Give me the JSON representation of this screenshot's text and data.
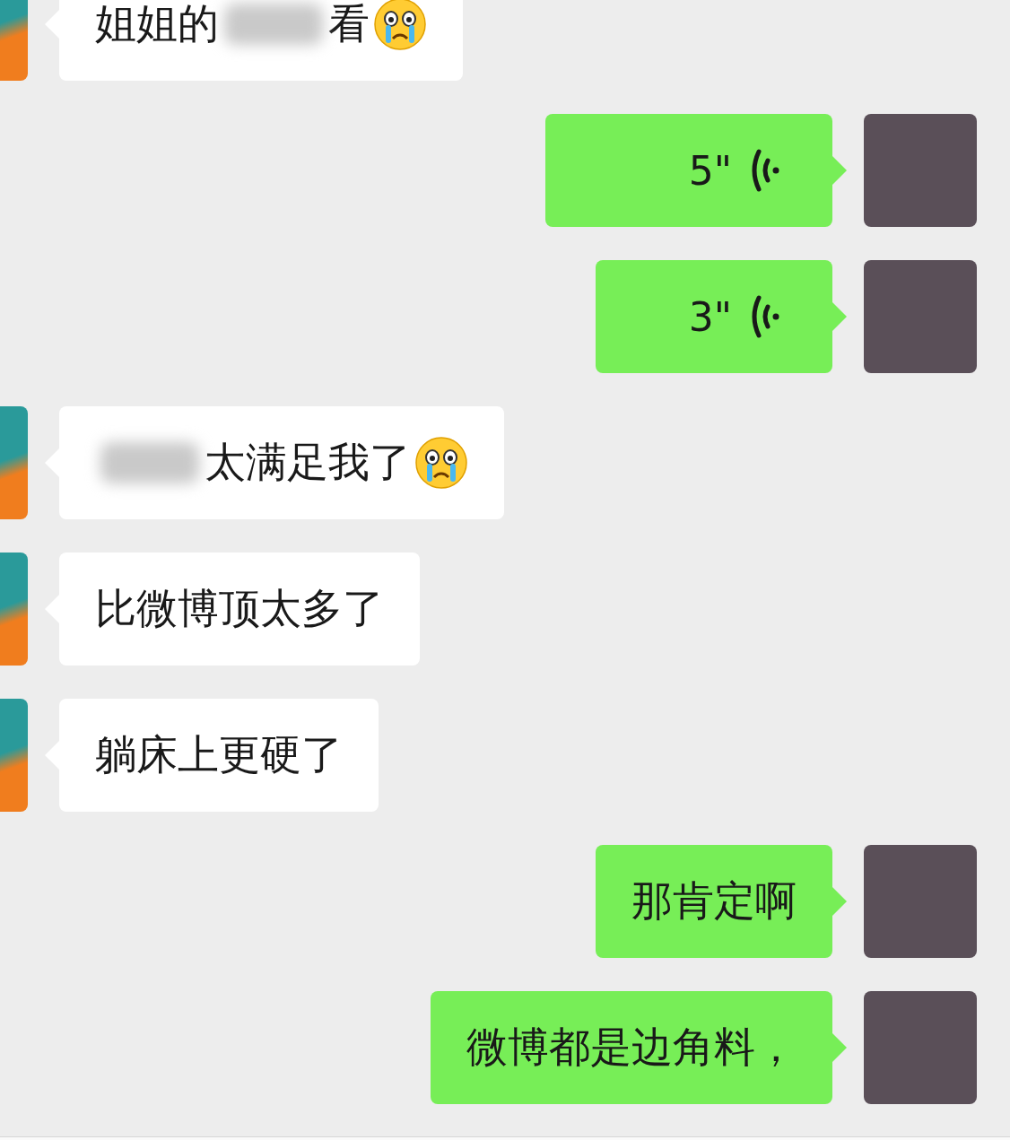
{
  "messages": [
    {
      "outgoing": false,
      "kind": "text",
      "segments": [
        {
          "kind": "text",
          "text": "姐姐的"
        },
        {
          "kind": "redacted"
        },
        {
          "kind": "text",
          "text": "看"
        },
        {
          "kind": "emoji"
        }
      ]
    },
    {
      "outgoing": true,
      "kind": "voice",
      "duration": "5\""
    },
    {
      "outgoing": true,
      "kind": "voice",
      "duration": "3\""
    },
    {
      "outgoing": false,
      "kind": "text",
      "segments": [
        {
          "kind": "redacted"
        },
        {
          "kind": "text",
          "text": "太满足我了"
        },
        {
          "kind": "emoji"
        }
      ]
    },
    {
      "outgoing": false,
      "kind": "text",
      "segments": [
        {
          "kind": "text",
          "text": "比微博顶太多了"
        }
      ]
    },
    {
      "outgoing": false,
      "kind": "text",
      "segments": [
        {
          "kind": "text",
          "text": "躺床上更硬了"
        }
      ]
    },
    {
      "outgoing": true,
      "kind": "text",
      "segments": [
        {
          "kind": "text",
          "text": "那肯定啊"
        }
      ]
    },
    {
      "outgoing": true,
      "kind": "text",
      "segments": [
        {
          "kind": "text",
          "text": "微博都是边角料，"
        }
      ]
    }
  ]
}
